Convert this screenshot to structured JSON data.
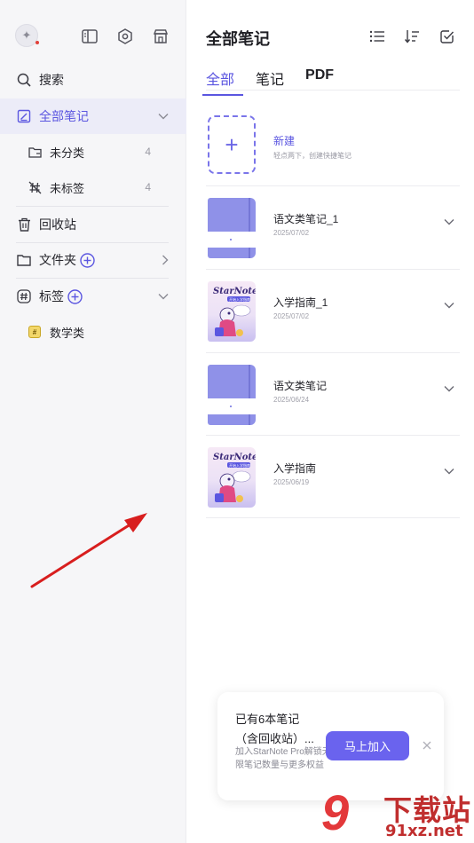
{
  "sidebar": {
    "avatar_glyph": "✦",
    "items": {
      "search": "搜索",
      "all_notes": "全部笔记",
      "uncategorized": "未分类",
      "uncategorized_count": "4",
      "untagged": "未标签",
      "untagged_count": "4",
      "trash": "回收站",
      "folders": "文件夹",
      "tags": "标签",
      "tag_math": "数学类"
    },
    "tag_badge": "#"
  },
  "header": {
    "title": "全部笔记"
  },
  "tabs": [
    "全部",
    "笔记",
    "PDF"
  ],
  "new_note": {
    "plus": "+",
    "title": "新建",
    "hint": "轻点两下，创建快捷笔记"
  },
  "notes": [
    {
      "name": "语文类笔记_1",
      "date": "2025/07/02",
      "cover": "plain"
    },
    {
      "name": "入学指南_1",
      "date": "2025/07/02",
      "cover": "art"
    },
    {
      "name": "语文类笔记",
      "date": "2025/06/24",
      "cover": "plain"
    },
    {
      "name": "入学指南",
      "date": "2025/06/19",
      "cover": "art"
    }
  ],
  "cover_art_text": {
    "brand": "StarNote",
    "caption": "开始入学指南"
  },
  "promo": {
    "line1": "已有6本笔记",
    "line2": "（含回收站）...",
    "desc": "加入StarNote Pro解锁无限笔记数量与更多权益",
    "join": "马上加入",
    "close": "×"
  },
  "watermark": {
    "logo": "9",
    "brand": "下载站",
    "url": "91xz.net"
  },
  "colors": {
    "accent": "#5b56e0",
    "button": "#6a63ee",
    "arrow": "#d81e1e"
  }
}
